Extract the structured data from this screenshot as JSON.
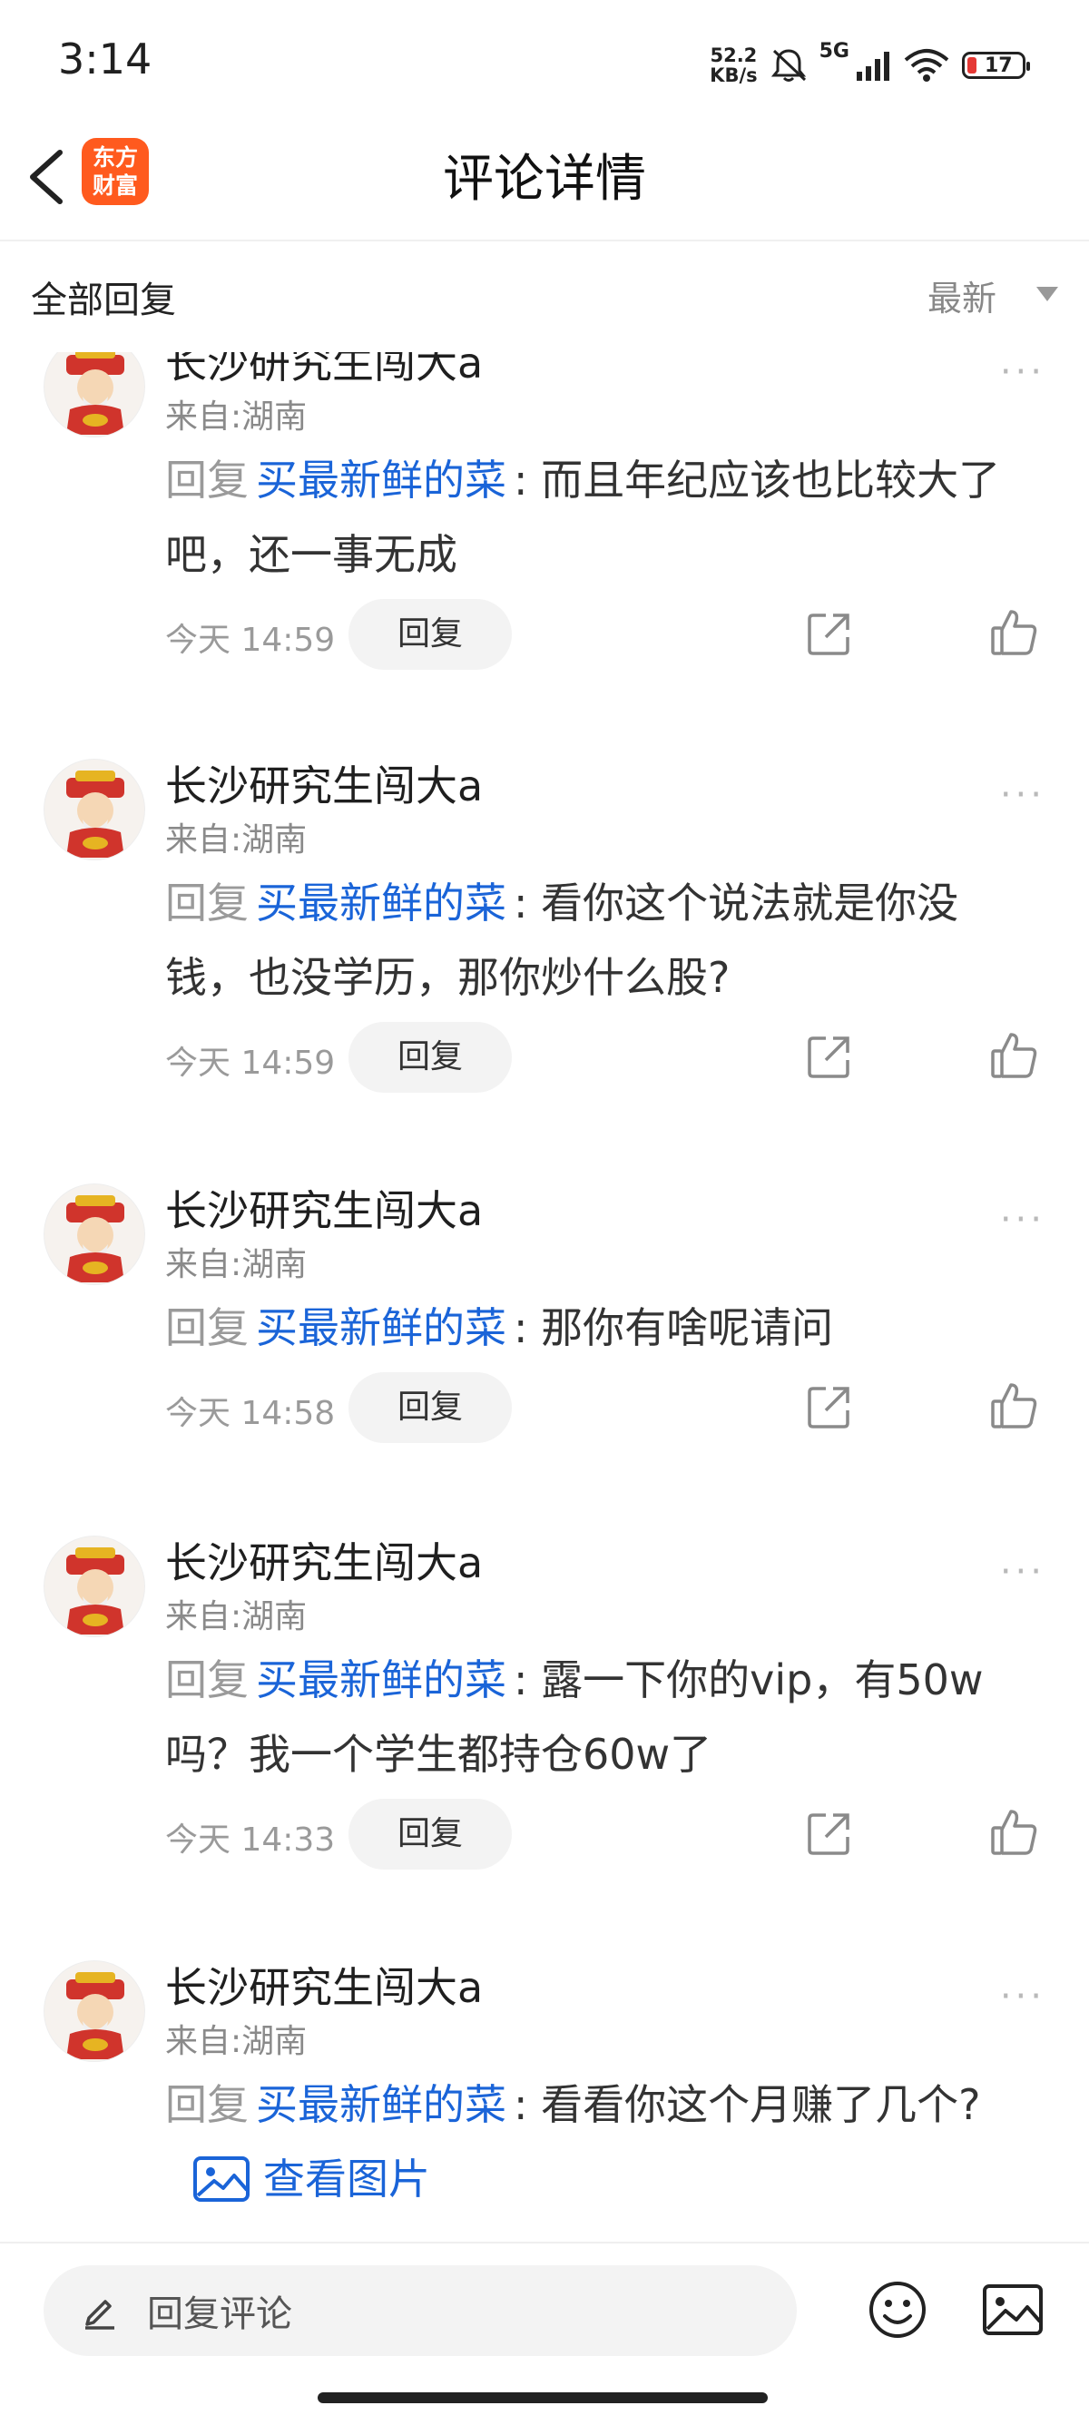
{
  "status_bar": {
    "time": "3:14",
    "net_speed_value": "52.2",
    "net_speed_unit": "KB/s",
    "network": "5G",
    "battery": "17",
    "icons": [
      "mute-icon",
      "signal-icon",
      "wifi-icon",
      "battery-icon"
    ]
  },
  "nav": {
    "title": "评论详情",
    "app_logo_line1": "东方",
    "app_logo_line2": "财富",
    "back_icon": "chevron-left-icon",
    "brand_color": "#ff5a1e"
  },
  "subheader": {
    "all_replies": "全部回复",
    "sort": "最新"
  },
  "comments": [
    {
      "user": "长沙研究生闯大a",
      "location": "来自:湖南",
      "reply_prefix": "回复",
      "mention": "买最新鲜的菜",
      "separator": ":",
      "text": "而且年纪应该也比较大了吧，还一事无成",
      "time": "今天 14:59",
      "reply_label": "回复"
    },
    {
      "user": "长沙研究生闯大a",
      "location": "来自:湖南",
      "reply_prefix": "回复",
      "mention": "买最新鲜的菜",
      "separator": ":",
      "text": "看你这个说法就是你没钱，也没学历，那你炒什么股?",
      "time": "今天 14:59",
      "reply_label": "回复"
    },
    {
      "user": "长沙研究生闯大a",
      "location": "来自:湖南",
      "reply_prefix": "回复",
      "mention": "买最新鲜的菜",
      "separator": ":",
      "text": "那你有啥呢请问",
      "time": "今天 14:58",
      "reply_label": "回复"
    },
    {
      "user": "长沙研究生闯大a",
      "location": "来自:湖南",
      "reply_prefix": "回复",
      "mention": "买最新鲜的菜",
      "separator": ":",
      "text": "露一下你的vip，有50w吗？我一个学生都持仓60w了",
      "time": "今天 14:33",
      "reply_label": "回复"
    },
    {
      "user": "长沙研究生闯大a",
      "location": "来自:湖南",
      "reply_prefix": "回复",
      "mention": "买最新鲜的菜",
      "separator": ":",
      "text": "看看你这个月赚了几个?",
      "view_image": "查看图片"
    }
  ],
  "bottom_bar": {
    "reply_placeholder": "回复评论",
    "icons": [
      "pencil-icon",
      "emoji-icon",
      "image-icon"
    ]
  },
  "colors": {
    "mention": "#1a64d8",
    "muted": "#9a9a9a"
  }
}
